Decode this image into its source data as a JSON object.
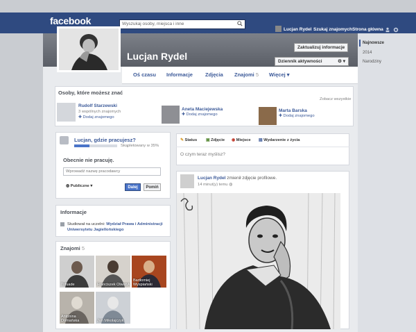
{
  "header": {
    "logo": "facebook",
    "search_placeholder": "Wyszukaj osoby, miejsca i inne",
    "user_name": "Lucjan Rydel",
    "nav_find_friends": "Szukaj znajomych",
    "nav_home": "Strona główna"
  },
  "profile": {
    "name": "Lucjan Rydel",
    "update_info_label": "Zaktualizuj informacje",
    "activity_log_label": "Dziennik aktywności"
  },
  "tabs": [
    {
      "label": "Oś czasu"
    },
    {
      "label": "Informacje"
    },
    {
      "label": "Zdjęcia"
    },
    {
      "label": "Znajomi",
      "count": "5"
    },
    {
      "label": "Więcej"
    }
  ],
  "suggestions": {
    "title": "Osoby, które możesz znać",
    "see_all": "Zobacz wszystkie",
    "people": [
      {
        "name": "Rudolf Starzewski",
        "mutual": "3 wspólnych znajomych",
        "action": "Dodaj znajomego"
      },
      {
        "name": "Aneta Maciejewska",
        "mutual": "",
        "action": "Dodaj znajomego"
      },
      {
        "name": "Marta Barska",
        "mutual": "",
        "action": "Dodaj znajomego"
      }
    ]
  },
  "work": {
    "question": "Lucjan, gdzie pracujesz?",
    "progress_label": "Skąpletowany w 35%",
    "progress_fraction": 0.35,
    "status_line": "Obecnie nie pracuję.",
    "input_placeholder": "Wprowadź nazwę pracodawcy",
    "privacy_label": "Publiczne",
    "save_label": "Dalej",
    "skip_label": "Pomiń"
  },
  "info": {
    "title": "Informacje",
    "study_prefix": "Studiował na uczelni:",
    "study_school": "Wydział Prawa i Administracji Uniwersytetu Jagiellońskiego"
  },
  "friends": {
    "title": "Znajomi",
    "count": "5",
    "items": [
      {
        "name": "Tofuade"
      },
      {
        "name": "Franciszek Olwatyk"
      },
      {
        "name": "Bartłomiej Wyspiański"
      },
      {
        "name": "Antonina Domańska"
      },
      {
        "name": "Jan Mikolajczyk"
      }
    ]
  },
  "composer": {
    "status": "Status",
    "photo": "Zdjęcie",
    "place": "Miejsce",
    "event": "Wydarzenie z życia",
    "placeholder": "O czym teraz myślisz?"
  },
  "post": {
    "author": "Lucjan Rydel",
    "action": "zmienił zdjęcie profilowe.",
    "time": "14 minut(y) temu"
  },
  "sidebar": {
    "items": [
      "Najnowsze",
      "2014",
      "Narodziny"
    ]
  },
  "colors": {
    "topbar": "#2f4a80",
    "link": "#3b5998",
    "progress": "#4a74c9"
  }
}
